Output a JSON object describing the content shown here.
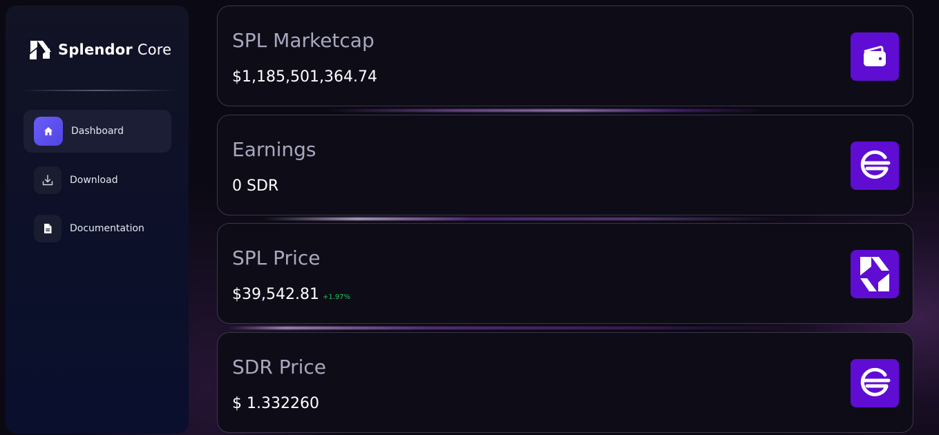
{
  "brand": {
    "bold": "Splendor",
    "regular": "Core",
    "logo_icon": "splendor-logo-icon"
  },
  "nav": {
    "items": [
      {
        "label": "Dashboard",
        "icon": "home-icon",
        "active": true
      },
      {
        "label": "Download",
        "icon": "download-icon",
        "active": false
      },
      {
        "label": "Documentation",
        "icon": "document-icon",
        "active": false
      }
    ]
  },
  "cards": [
    {
      "title": "SPL Marketcap",
      "value": "$1,185,501,364.74",
      "change": "",
      "icon": "wallet-icon"
    },
    {
      "title": "Earnings",
      "value": "0 SDR",
      "change": "",
      "icon": "sdr-icon"
    },
    {
      "title": "SPL Price",
      "value": "$39,542.81",
      "change": "+1.97%",
      "icon": "splendor-logo-icon"
    },
    {
      "title": "SDR Price",
      "value": "$ 1.332260",
      "change": "",
      "icon": "sdr-icon"
    }
  ],
  "colors": {
    "accent": "#5f0cd3",
    "active_nav": "#5b4ff0",
    "positive": "#22c55e",
    "card_title": "#a8a9bf"
  }
}
